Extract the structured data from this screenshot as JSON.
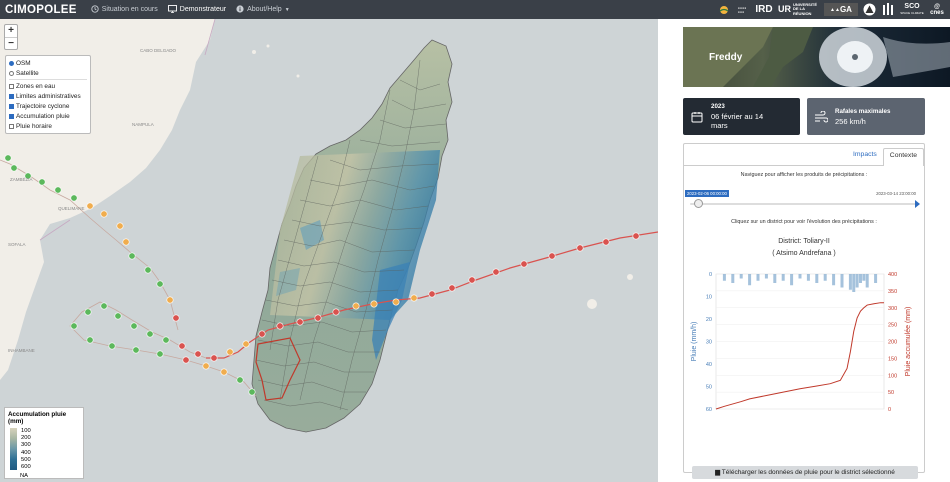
{
  "navbar": {
    "brand": "CIMOPOLEE",
    "items": [
      {
        "label": "Situation en cours",
        "icon": "clock-icon"
      },
      {
        "label": "Demonstrateur",
        "icon": "monitor-icon"
      },
      {
        "label": "About/Help",
        "icon": "info-icon"
      }
    ],
    "logos": [
      "logo-1",
      "IRD",
      "UNIVERSITÉ DE LA RÉUNION",
      "logo-4",
      "GA",
      "logo-6",
      "logo-7",
      "SCO",
      "cnes"
    ]
  },
  "map": {
    "zoom_in": "+",
    "zoom_out": "−",
    "base_layers": [
      {
        "label": "OSM",
        "checked": true
      },
      {
        "label": "Satellite",
        "checked": false
      }
    ],
    "overlays": [
      {
        "label": "Zones en eau",
        "checked": false
      },
      {
        "label": "Limites administratives",
        "checked": true
      },
      {
        "label": "Trajectoire cyclone",
        "checked": true
      },
      {
        "label": "Accumulation pluie",
        "checked": true
      },
      {
        "label": "Pluie horaire",
        "checked": false
      }
    ],
    "place_labels": [
      "CABO DELGADO",
      "NAMPULA",
      "ZAMBÉZIA",
      "SOFALA",
      "INHAMBANE",
      "QUELIMANE"
    ],
    "legend": {
      "title": "Accumulation pluie (mm)",
      "ticks": [
        "100",
        "200",
        "300",
        "400",
        "500",
        "600"
      ],
      "na": "NA",
      "colors": [
        "#d8d3bc",
        "#a8b7a3",
        "#6a98a8",
        "#2d6f94",
        "#1f5a82"
      ]
    }
  },
  "panel": {
    "banner_title": "Freddy",
    "date_card": {
      "label": "2023",
      "value_line1": "06 février au 14",
      "value_line2": "mars",
      "icon": "calendar-icon"
    },
    "wind_card": {
      "label": "Rafales maximales",
      "value": "256 km/h",
      "icon": "wind-icon"
    },
    "tabs": [
      {
        "label": "Impacts",
        "active": false
      },
      {
        "label": "Contexte",
        "active": true
      }
    ],
    "hint_products": "Naviguez pour afficher les produits de précipitations :",
    "slider_start": "2023-02-06 00:00:00",
    "slider_end": "2023-03-14 23:00:00",
    "slider_position": 0,
    "hint_district": "Cliquez sur un district pour voir l'évolution des précipitations :",
    "district_line1": "District: Toliary-II",
    "district_line2": "( Atsimo Andrefana )",
    "download_label": "Télécharger les données de pluie pour le district sélectionné"
  },
  "chart_data": {
    "type": "line",
    "title": "",
    "y_left": {
      "label": "Pluie (mm/h)",
      "range": [
        60,
        0
      ],
      "ticks": [
        0,
        10,
        20,
        30,
        40,
        50,
        60
      ],
      "color": "#4a7fb8"
    },
    "y_right": {
      "label": "Pluie accumulée (mm)",
      "range": [
        0,
        400
      ],
      "ticks": [
        0,
        50,
        100,
        150,
        200,
        250,
        300,
        350,
        400
      ],
      "color": "#c0392b"
    },
    "series": [
      {
        "name": "Pluie accumulée (mm)",
        "axis": "right",
        "x": [
          0,
          0.05,
          0.1,
          0.15,
          0.2,
          0.3,
          0.4,
          0.5,
          0.6,
          0.68,
          0.74,
          0.78,
          0.8,
          0.82,
          0.84,
          0.86,
          0.88,
          0.9,
          0.94,
          0.98,
          1
        ],
        "values": [
          0,
          8,
          15,
          22,
          30,
          40,
          50,
          60,
          68,
          75,
          85,
          120,
          170,
          230,
          270,
          290,
          300,
          308,
          312,
          315,
          315
        ]
      },
      {
        "name": "Pluie (mm/h)",
        "axis": "left",
        "type": "bar",
        "x": [
          0.05,
          0.1,
          0.15,
          0.2,
          0.25,
          0.3,
          0.35,
          0.4,
          0.45,
          0.5,
          0.55,
          0.6,
          0.65,
          0.7,
          0.75,
          0.8,
          0.82,
          0.84,
          0.86,
          0.88,
          0.9,
          0.95
        ],
        "values": [
          3,
          4,
          2,
          5,
          3,
          2,
          4,
          3,
          5,
          2,
          3,
          4,
          3,
          5,
          6,
          7,
          8,
          6,
          4,
          3,
          6,
          4
        ]
      }
    ]
  }
}
